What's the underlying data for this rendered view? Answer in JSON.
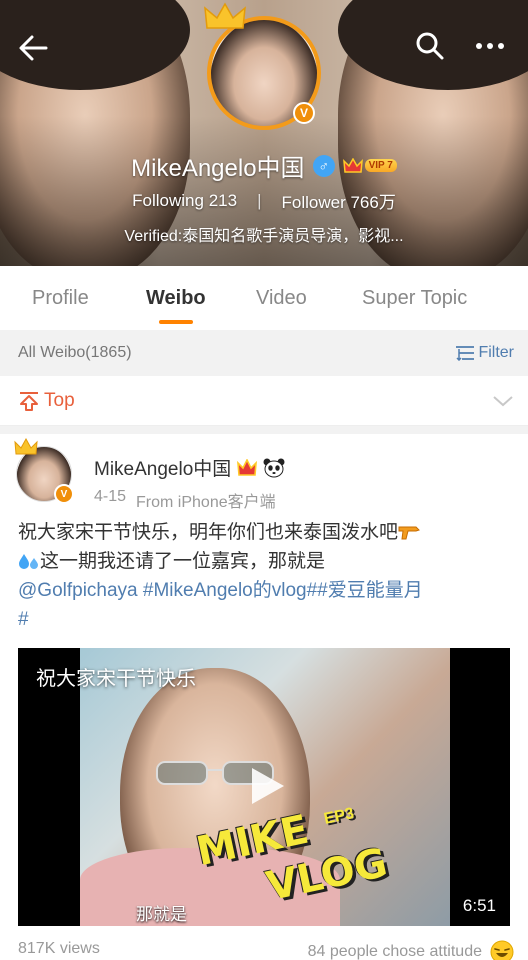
{
  "profile": {
    "name": "MikeAngelo中国",
    "vip_label": "VIP 7",
    "following_label": "Following",
    "following_count": "213",
    "follower_label": "Follower",
    "follower_count": "766万",
    "separator": "|",
    "verified_text": "Verified:泰国知名歌手演员导演，影视...",
    "verified_mark": "V",
    "gender_symbol": "♂"
  },
  "tabs": [
    {
      "label": "Profile",
      "active": false
    },
    {
      "label": "Weibo",
      "active": true
    },
    {
      "label": "Video",
      "active": false
    },
    {
      "label": "Super Topic",
      "active": false
    }
  ],
  "filter_bar": {
    "all_count": "All Weibo(1865)",
    "filter_label": "Filter"
  },
  "top_row": {
    "label": "Top"
  },
  "post": {
    "author": "MikeAngelo中国",
    "date": "4-15",
    "source": "From iPhone客户端",
    "verified_mark": "V",
    "text_line1": "祝大家宋干节快乐，明年你们也来泰国泼水吧",
    "text_line2": "这一期我还请了一位嘉宾，那就是",
    "mention": "@Golfpichaya",
    "hashtag1": " #MikeAngelo的vlog#",
    "hashtag2": "#爱豆能量月",
    "hashtag2_end": "#",
    "video": {
      "title": "祝大家宋干节快乐",
      "logo_line1": "MIKE",
      "logo_ep": "EP3",
      "logo_line2": "VLOG",
      "subtitle": "那就是",
      "duration": "6:51"
    },
    "views": "817K views",
    "attitude": "84 people chose attitude"
  },
  "colors": {
    "accent": "#ff8200",
    "link": "#507daf",
    "top_red": "#e8603c"
  }
}
